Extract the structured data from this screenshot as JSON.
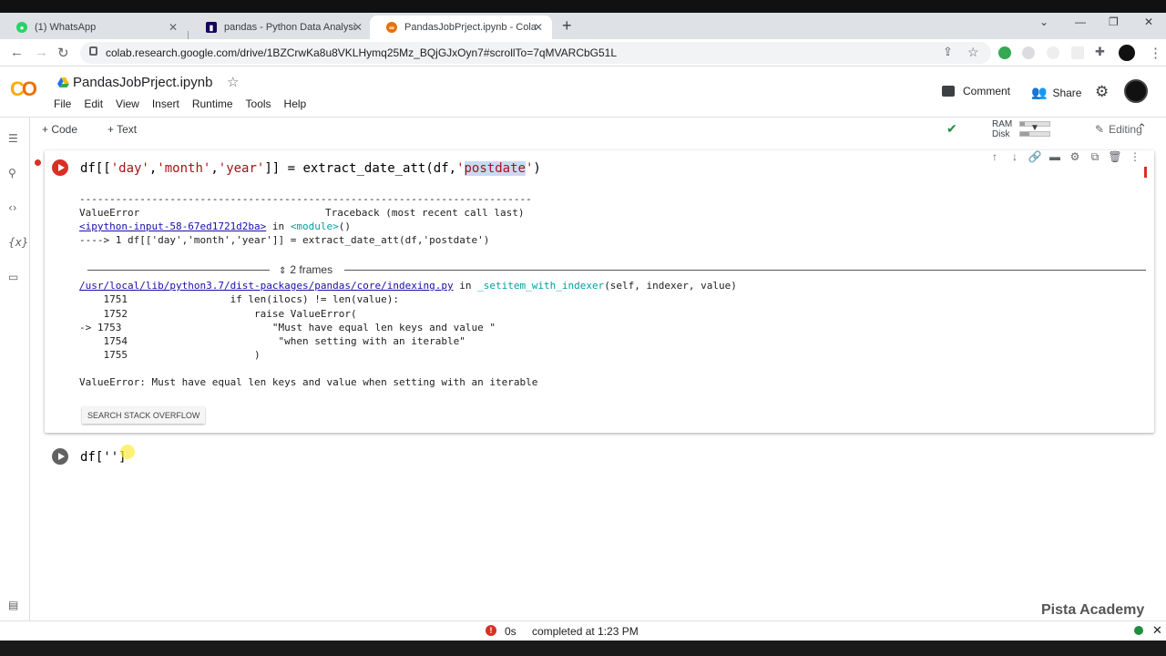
{
  "browser": {
    "tabs": [
      {
        "label": "(1) WhatsApp",
        "icon": "whatsapp-icon"
      },
      {
        "label": "pandas - Python Data Analysis Lib",
        "icon": "pandas-icon"
      },
      {
        "label": "PandasJobPrject.ipynb - Colabora",
        "icon": "colab-icon"
      }
    ],
    "url": "colab.research.google.com/drive/1BZCrwKa8u8VKLHymq25Mz_BQjGJxOyn7#scrollTo=7qMVARCbG51L"
  },
  "notebook": {
    "logo": "CO",
    "title": "PandasJobPrject.ipynb",
    "menu": [
      "File",
      "Edit",
      "View",
      "Insert",
      "Runtime",
      "Tools",
      "Help"
    ],
    "comment_label": "Comment",
    "share_label": "Share",
    "add_code": "+ Code",
    "add_text": "+ Text",
    "ram_label": "RAM",
    "disk_label": "Disk",
    "ram_fraction": 0.15,
    "disk_fraction": 0.3,
    "editing_label": "Editing"
  },
  "cell1": {
    "code_prefix": "df[[",
    "s1": "'day'",
    "c1": ",",
    "s2": "'month'",
    "c2": ",",
    "s3": "'year'",
    "mid": "]] = extract_date_att(df,",
    "q1": "'",
    "hl": "postdate",
    "q2": "'",
    "end": ")",
    "output": {
      "dashes": "---------------------------------------------------------------------------",
      "error_name": "ValueError",
      "traceback_title": "Traceback (most recent call last)",
      "input_link": "<ipython-input-58-67ed1721d2ba>",
      "in_text": " in ",
      "module": "<module>",
      "module_paren": "()",
      "arrow_line": "----> 1 df[['day','month','year']] = extract_date_att(df,'postdate')",
      "frames_label": "2 frames",
      "path_link": "/usr/local/lib/python3.7/dist-packages/pandas/core/indexing.py",
      "path_in": " in ",
      "func": "_setitem_with_indexer",
      "func_args": "(self, indexer, value)",
      "lines": [
        "    1751                 if len(ilocs) != len(value):",
        "    1752                     raise ValueError(",
        "-> 1753                         \"Must have equal len keys and value \"",
        "    1754                         \"when setting with an iterable\"",
        "    1755                     )"
      ],
      "final_error": "ValueError: Must have equal len keys and value when setting with an iterable"
    },
    "so_button": "SEARCH STACK OVERFLOW"
  },
  "cell2": {
    "code": "df['']"
  },
  "status": {
    "time": "0s",
    "completed": "completed at 1:23 PM"
  },
  "watermark": "Pista Academy",
  "colors": {
    "error_red": "#d93025",
    "run_gray": "#616161",
    "green": "#1e8e3e"
  }
}
